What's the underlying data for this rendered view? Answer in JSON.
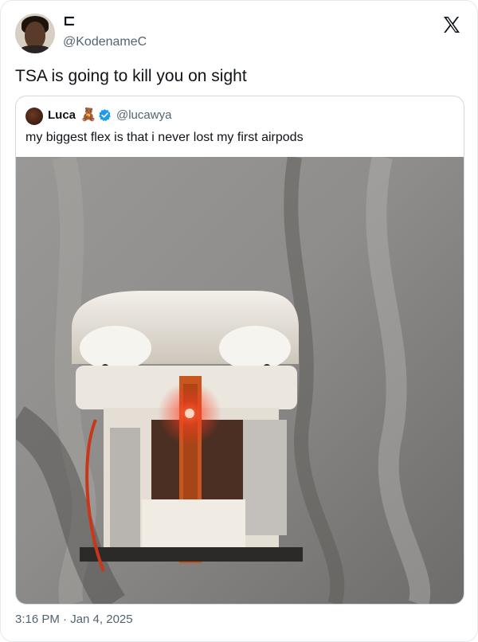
{
  "tweet": {
    "display_name": "⊏",
    "handle": "@KodenameC",
    "text": "TSA is going to kill you on sight",
    "timestamp": "3:16 PM · Jan 4, 2025",
    "platform_icon": "x-logo-icon"
  },
  "quoted_tweet": {
    "display_name": "Luca",
    "name_emoji": "🧸",
    "verified_icon": "verified-badge-icon",
    "handle": "@lucawya",
    "text": "my biggest flex is that i never lost my first airpods",
    "image_description_icon": "modified-airpods-case-photo"
  },
  "colors": {
    "text_primary": "#0f1419",
    "text_secondary": "#536471",
    "border": "#cfd9de",
    "verified_blue": "#1d9bf0",
    "led_red": "#ff3b1f"
  }
}
